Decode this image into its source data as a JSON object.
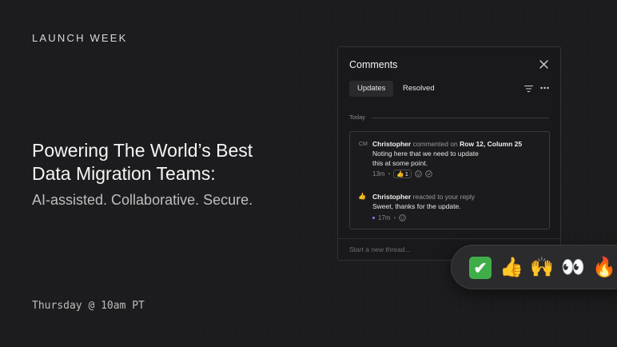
{
  "hero": {
    "eyebrow": "LAUNCH WEEK",
    "headline_line1": "Powering The World’s Best",
    "headline_line2": "Data Migration Teams:",
    "subline": "AI-assisted. Collaborative. Secure.",
    "schedule": "Thursday @ 10am PT"
  },
  "panel": {
    "title": "Comments",
    "tabs": [
      {
        "label": "Updates",
        "active": true
      },
      {
        "label": "Resolved",
        "active": false
      }
    ],
    "day_label": "Today",
    "thread": {
      "comment": {
        "avatar": "CM",
        "author": "Christopher",
        "action": "commented on",
        "target": "Row 12, Column 25",
        "body_line1": "Noting here that we need to update",
        "body_line2": "this at some point.",
        "time": "13m",
        "reaction_emoji": "👍",
        "reaction_count": "1"
      },
      "reaction": {
        "avatar_emoji": "👍",
        "author": "Christopher",
        "action": "reacted to your reply",
        "body": "Sweet, thanks for the update.",
        "time": "17m"
      }
    },
    "composer_placeholder": "Start a new thread..."
  },
  "emoji_bar": {
    "items": [
      "✔",
      "👍",
      "🙌",
      "👀",
      "🔥"
    ]
  },
  "colors": {
    "background": "#1c1c1e",
    "panel": "#19191b",
    "unread_dot": "#8b7cf6",
    "check_green": "#3fae49"
  }
}
